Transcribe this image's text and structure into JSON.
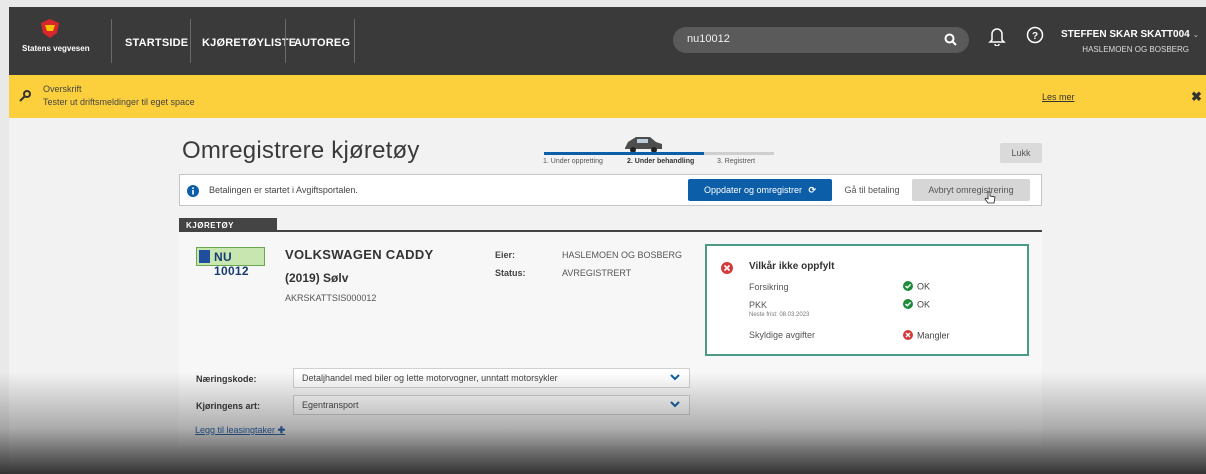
{
  "nav": {
    "logo_text": "Statens vegvesen",
    "links": [
      "STARTSIDE",
      "KJØRETØYLISTE",
      "AUTOREG"
    ],
    "search_value": "nu10012",
    "user_name": "STEFFEN SKAR SKATT004",
    "user_org": "HASLEMOEN OG BOSBERG",
    "icons": [
      "search-icon",
      "bell-icon",
      "help-icon",
      "chevron-down-icon"
    ]
  },
  "banner": {
    "title": "Overskrift",
    "text": "Tester ut driftsmeldinger til eget space",
    "more": "Les mer",
    "close": "✖",
    "color": "#fcd03d"
  },
  "page": {
    "title": "Omregistrere kjøretøy",
    "steps": [
      "1. Under oppretting",
      "2. Under behandling",
      "3. Registrert"
    ],
    "active_step": 2,
    "close_button": "Lukk"
  },
  "alert": {
    "text": "Betalingen er startet i Avgiftsportalen.",
    "update_button": "Oppdater og omregistrer",
    "pay_button": "Gå til betaling",
    "cancel_button": "Avbryt omregistrering"
  },
  "vehicle": {
    "section": "KJØRETØY",
    "plate": "NU 10012",
    "name": "VOLKSWAGEN CADDY",
    "year_color": "(2019) Sølv",
    "code": "AKRSKATTSIS000012",
    "owner_label": "Eier:",
    "owner": "HASLEMOEN OG BOSBERG",
    "status_label": "Status:",
    "status": "AVREGISTRERT"
  },
  "conditions": {
    "title": "Vilkår ikke oppfylt",
    "items": [
      {
        "label": "Forsikring",
        "status": "OK",
        "ok": true
      },
      {
        "label": "PKK",
        "sub": "Neste frist: 08.03.2023",
        "status": "OK",
        "ok": true
      },
      {
        "label": "Skyldige avgifter",
        "status": "Mangler",
        "ok": false
      }
    ]
  },
  "form": {
    "industry_label": "Næringskode:",
    "industry_value": "Detaljhandel med biler og lette motorvogner, unntatt motorsykler",
    "transport_label": "Kjøringens art:",
    "transport_value": "Egentransport",
    "lease_link": "Legg til leasingtaker"
  },
  "colors": {
    "primary": "#0d5ea8",
    "ok": "#1f8a3a",
    "error": "#d23b3b",
    "nav_bg": "#3a3a3a"
  }
}
